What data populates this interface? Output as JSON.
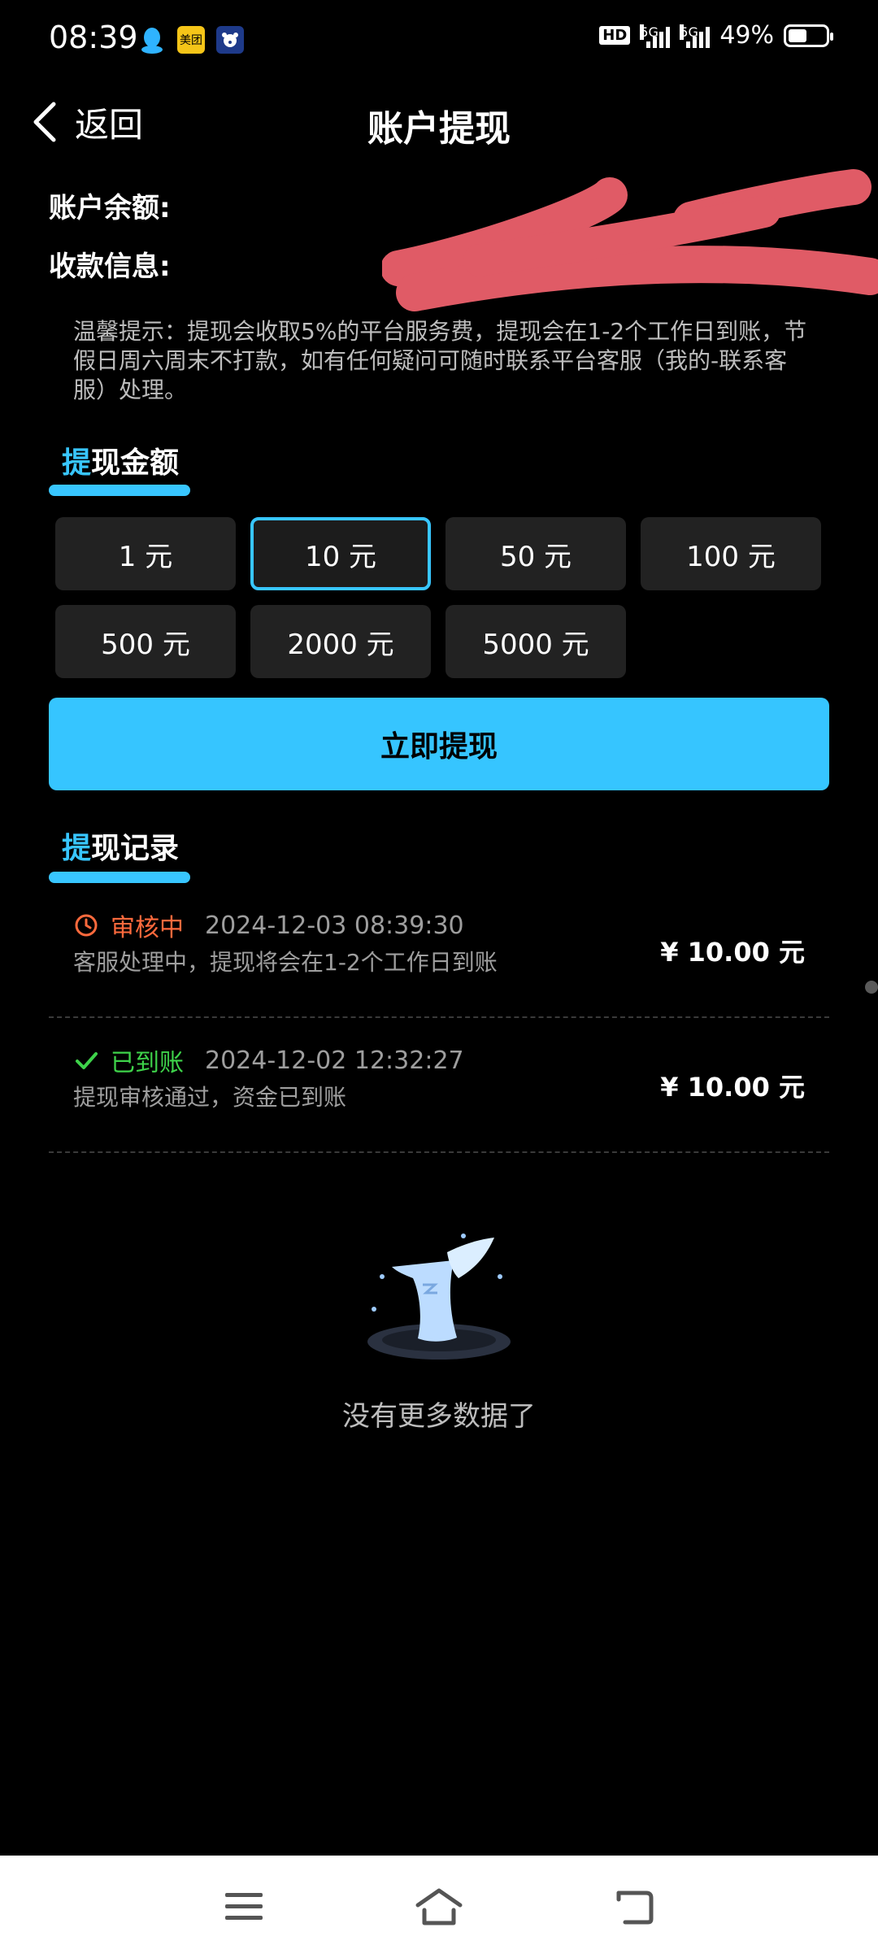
{
  "status_bar": {
    "time": "08:39",
    "notification_icons": [
      "qq-icon",
      "meituan-icon",
      "bear-app-icon"
    ],
    "meituan_text": "美团",
    "hd_label": "HD",
    "signal_1": "5G",
    "signal_2": "5G",
    "battery_percent": "49%",
    "battery_level": 0.49
  },
  "header": {
    "back_label": "返回",
    "title": "账户提现"
  },
  "account": {
    "balance_label": "账户余额:",
    "receive_label": "收款信息:"
  },
  "tip": "温馨提示：提现会收取5%的平台服务费，提现会在1-2个工作日到账，节假日周六周末不打款，如有任何疑问可随时联系平台客服（我的-联系客服）处理。",
  "withdraw_section": {
    "title_accent": "提",
    "title_rest": "现金额",
    "amounts": [
      "1 元",
      "10 元",
      "50 元",
      "100 元",
      "500 元",
      "2000 元",
      "5000 元"
    ],
    "selected_index": 1,
    "submit_label": "立即提现"
  },
  "records_section": {
    "title_accent": "提",
    "title_rest": "现记录",
    "records": [
      {
        "status": "审核中",
        "datetime": "2024-12-03 08:39:30",
        "description": "客服处理中，提现将会在1-2个工作日到账",
        "amount": "¥ 10.00 元",
        "status_color": "#ff6a3d"
      },
      {
        "status": "已到账",
        "datetime": "2024-12-02 12:32:27",
        "description": "提现审核通过，资金已到账",
        "amount": "¥ 10.00 元",
        "status_color": "#3ed24a"
      }
    ],
    "empty_text": "没有更多数据了"
  },
  "colors": {
    "accent": "#38c6ff",
    "button": "#36c5ff",
    "background": "#000000",
    "card": "#222222"
  },
  "nav_bar": {
    "buttons": [
      "menu-icon",
      "home-icon",
      "back-icon"
    ]
  }
}
